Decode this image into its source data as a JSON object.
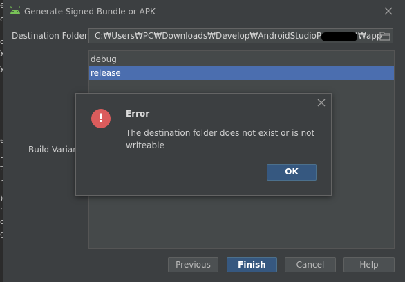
{
  "window": {
    "title": "Generate Signed Bundle or APK"
  },
  "background_chars": [
    "e",
    "c",
    "c",
    "y",
    "y",
    "e",
    "t",
    "t",
    "n",
    ")",
    "r",
    "c",
    "g"
  ],
  "destination": {
    "label": "Destination Folder:",
    "value_prefix": "C:₩Users₩PC₩Downloads₩Develop₩AndroidStudioProjects₩",
    "value_suffix": "₩app",
    "folder_icon": "folder-icon"
  },
  "build_variants": {
    "label": "Build Variants:",
    "items": [
      {
        "label": "debug",
        "selected": false
      },
      {
        "label": "release",
        "selected": true
      }
    ]
  },
  "buttons": {
    "previous": "Previous",
    "finish": "Finish",
    "cancel": "Cancel",
    "help": "Help"
  },
  "error_dialog": {
    "title": "Error",
    "message": "The destination folder does not exist or is not writeable",
    "ok": "OK",
    "icon": "error-icon",
    "color": "#db5c5c"
  },
  "colors": {
    "background": "#3c3f41",
    "selection": "#4b6eaf",
    "primary_button": "#365880"
  }
}
